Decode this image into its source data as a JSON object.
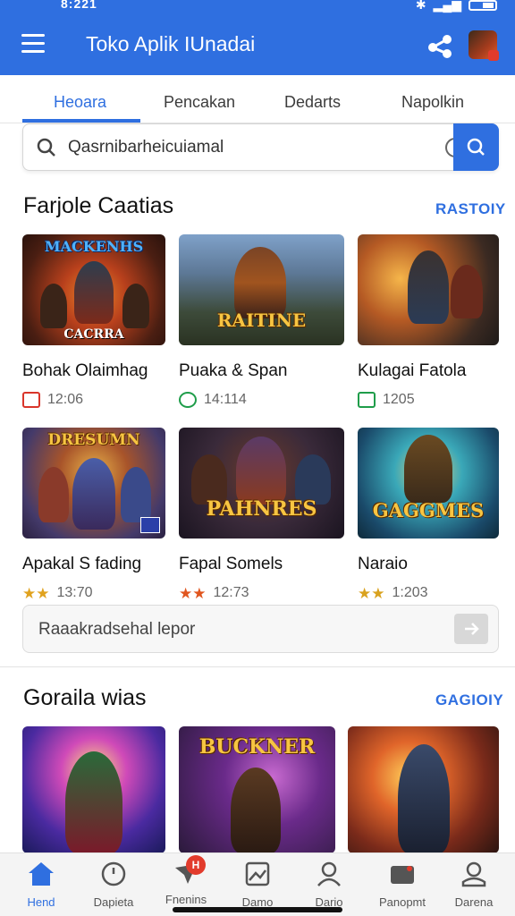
{
  "status_bar": {
    "time": "8:221"
  },
  "app": {
    "title": "Toko Aplik IUnadai"
  },
  "tabs": [
    {
      "label": "Heoara",
      "active": true
    },
    {
      "label": "Pencakan",
      "active": false
    },
    {
      "label": "Dedarts",
      "active": false
    },
    {
      "label": "Napolkin",
      "active": false
    }
  ],
  "search": {
    "value": "Qasrnibarheicuiamal"
  },
  "section1": {
    "title": "Farjole Caatias",
    "link": "RASTOIY",
    "cards": [
      {
        "name": "Bohak Olaimhag",
        "meta": "12:06",
        "banner_top": "MACKENHS",
        "banner_bottom": "CACRRA",
        "badge_color": "#d9352a",
        "theme": "fire"
      },
      {
        "name": "Puaka & Span",
        "meta": "14:114",
        "banner_top": "",
        "banner_bottom": "RAITINE",
        "badge_color": "#1f9d4a",
        "theme": "mountain"
      },
      {
        "name": "Kulagai Fatola",
        "meta": "1205",
        "banner_top": "",
        "banner_bottom": "",
        "badge_color": "#1f9d4a",
        "theme": "ember"
      },
      {
        "name": "Apakal S fading",
        "meta": "13:70",
        "banner_top": "DRESUMN",
        "banner_bottom": "",
        "badge_color": "#d9a21e",
        "theme": "battle"
      },
      {
        "name": "Fapal Somels",
        "meta": "12:73",
        "banner_top": "",
        "banner_bottom": "PAHNRES",
        "badge_color": "#e0551e",
        "theme": "dark"
      },
      {
        "name": "Naraio",
        "meta": "1:203",
        "banner_top": "",
        "banner_bottom": "GAGGMES",
        "badge_color": "#d9a21e",
        "theme": "teal"
      }
    ]
  },
  "promo": {
    "text": "Raaakradsehal lepor"
  },
  "section2": {
    "title": "Goraila wias",
    "link": "GAGIOIY",
    "cards": [
      {
        "banner_top": "",
        "theme": "cosmic"
      },
      {
        "banner_top": "BUCKNER",
        "theme": "purple"
      },
      {
        "banner_top": "",
        "theme": "blaze"
      }
    ]
  },
  "bottom_nav": [
    {
      "label": "Hend",
      "icon": "home-icon",
      "active": true
    },
    {
      "label": "Dapieta",
      "icon": "clock-icon",
      "active": false
    },
    {
      "label": "Fnenins",
      "icon": "notification-icon",
      "active": false,
      "badge": "H"
    },
    {
      "label": "Damo",
      "icon": "gallery-icon",
      "active": false
    },
    {
      "label": "Dario",
      "icon": "person-icon",
      "active": false
    },
    {
      "label": "Panopmt",
      "icon": "wallet-icon",
      "active": false
    },
    {
      "label": "Darena",
      "icon": "profile-icon",
      "active": false
    }
  ],
  "colors": {
    "primary": "#2f6fe0",
    "badge_red": "#e23b2c"
  }
}
